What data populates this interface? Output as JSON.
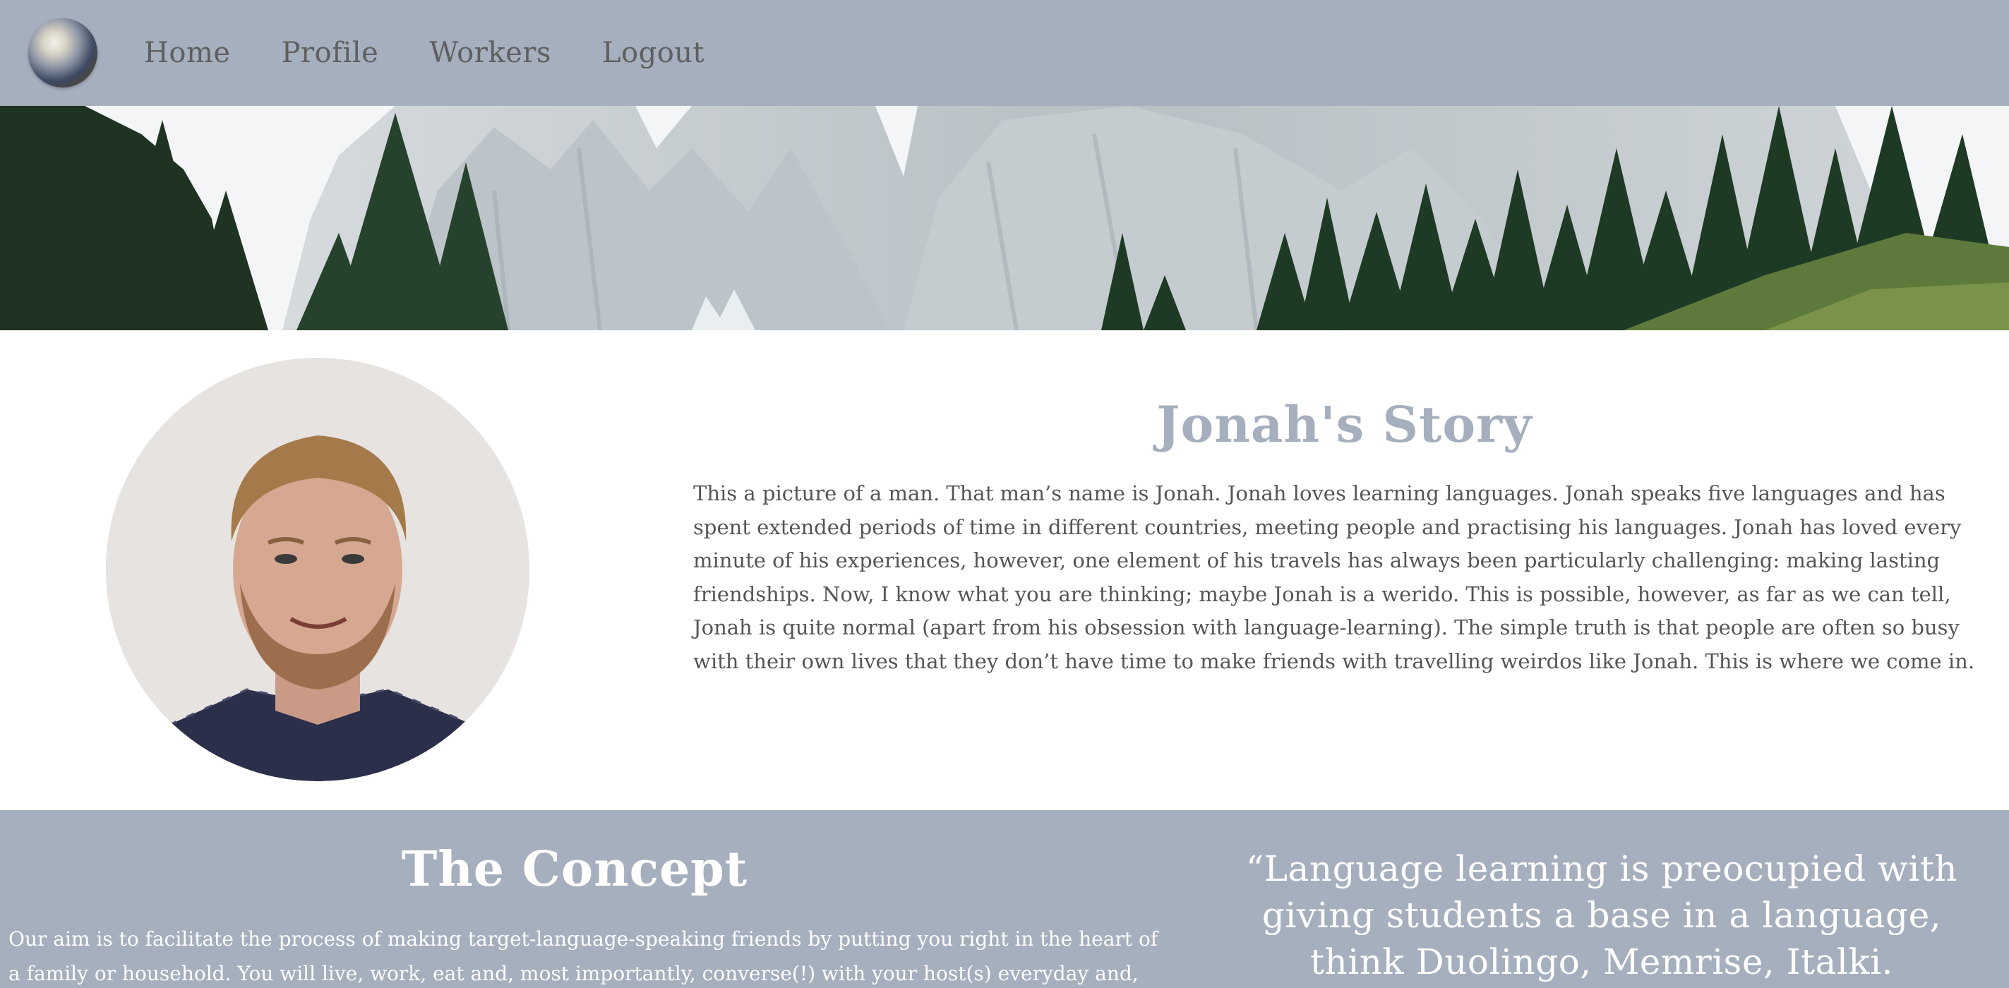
{
  "nav": {
    "links": [
      "Home",
      "Profile",
      "Workers",
      "Logout"
    ]
  },
  "story": {
    "title": "Jonah's Story",
    "text": "This a picture of a man. That man’s name is Jonah. Jonah loves learning languages. Jonah speaks five languages and has spent extended periods of time in different countries, meeting people and practising his languages. Jonah has loved every minute of his experiences, however, one element of his travels has always been particularly challenging: making lasting friendships. Now, I know what you are thinking; maybe Jonah is a werido. This is possible, however, as far as we can tell, Jonah is quite normal (apart from his obsession with language-learning). The simple truth is that people are often so busy with their own lives that they don’t have time to make friends with travelling weirdos like Jonah. This is where we come in."
  },
  "concept": {
    "title": "The Concept",
    "text": "Our aim is to facilitate the process of making target-language-speaking friends by putting you right in the heart of a family or household. You will live, work, eat and, most importantly, converse(!) with your host(s) everyday and, before",
    "quote": "“Language learning is preocupied with giving students a base in a language, think Duolingo, Memrise, Italki. Language Stay"
  },
  "colors": {
    "nav_bg": "#a5afbe",
    "accent": "#a5afbe",
    "text": "#555555"
  }
}
